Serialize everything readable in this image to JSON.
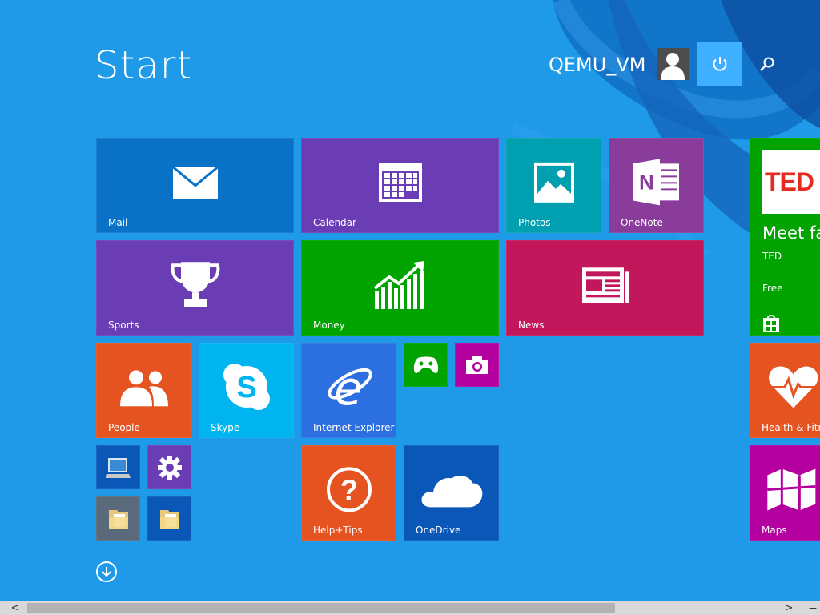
{
  "start": {
    "title": "Start"
  },
  "user": {
    "name": "QEMU_VM",
    "avatar_icon": "user-silhouette-icon"
  },
  "header": {
    "power_icon": "power-icon",
    "search_icon": "search-icon"
  },
  "tiles": {
    "mail": {
      "label": "Mail",
      "color": "#0a72c6"
    },
    "calendar": {
      "label": "Calendar",
      "color": "#6a3db5"
    },
    "photos": {
      "label": "Photos",
      "color": "#00a0b0"
    },
    "onenote": {
      "label": "OneNote",
      "color": "#8a3c9b"
    },
    "sports": {
      "label": "Sports",
      "color": "#6a3db5"
    },
    "money": {
      "label": "Money",
      "color": "#00a300"
    },
    "news": {
      "label": "News",
      "color": "#c2185b"
    },
    "people": {
      "label": "People",
      "color": "#e55320"
    },
    "skype": {
      "label": "Skype",
      "color": "#00b4f0"
    },
    "ie": {
      "label": "Internet Explorer",
      "color": "#2b6fe0"
    },
    "games": {
      "label": "",
      "color": "#00a300"
    },
    "camera": {
      "label": "",
      "color": "#b4009e"
    },
    "help": {
      "label": "Help+Tips",
      "color": "#e55320"
    },
    "onedrive": {
      "label": "OneDrive",
      "color": "#0a57b8"
    },
    "health": {
      "label": "Health & Fitne",
      "color": "#e55320"
    },
    "maps": {
      "label": "Maps",
      "color": "#b4009e"
    },
    "pc": {
      "label": "",
      "color": "#0a57b8"
    },
    "settings": {
      "label": "",
      "color": "#6a3db5"
    },
    "folder1": {
      "label": "",
      "color": "#5a6a7a"
    },
    "folder2": {
      "label": "",
      "color": "#0a57b8"
    }
  },
  "ted": {
    "logo": "TED",
    "title": "Meet fas",
    "publisher": "TED",
    "price": "Free",
    "color": "#00a300"
  },
  "scrollbar": {
    "left_arrow": "<",
    "right_arrow": ">",
    "minus": "−"
  }
}
